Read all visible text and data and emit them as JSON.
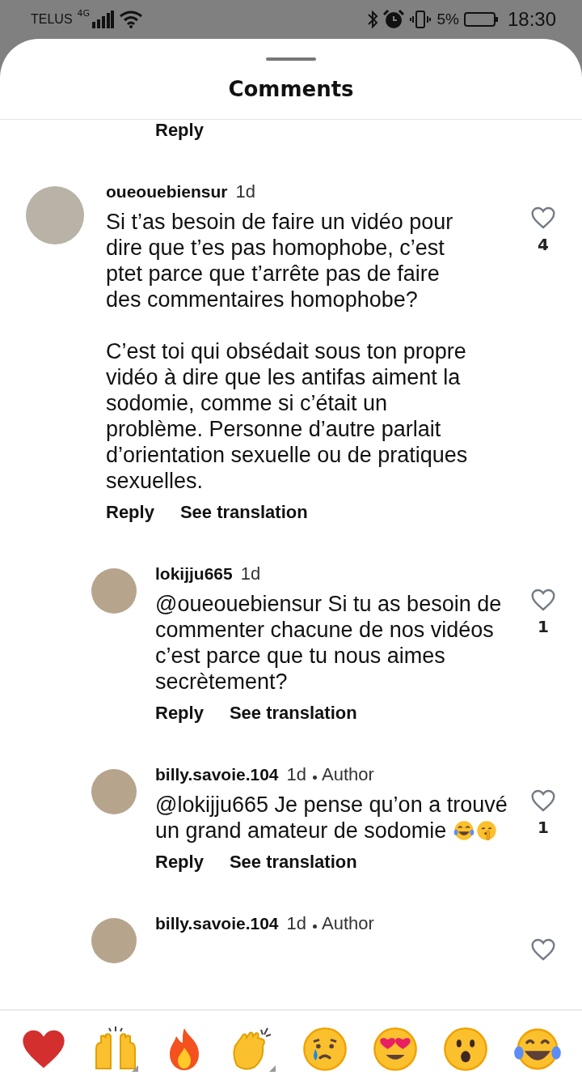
{
  "status_bar": {
    "carrier": "TELUS",
    "network": "4G",
    "battery": "5%",
    "time": "18:30"
  },
  "sheet": {
    "title": "Comments"
  },
  "partial_actions": [
    "Reply"
  ],
  "comments": [
    {
      "username": "oueouebiensur",
      "time": "1d",
      "paragraphs": [
        "Si t’as besoin de faire un vidéo pour dire que t’es pas homophobe, c’est ptet parce que t’arrête pas de faire des commentaires homophobe?",
        "C’est toi qui obsédait sous ton propre vidéo à dire que les antifas aiment la sodomie, comme si c’était un problème. Personne d’autre parlait d’orientation sexuelle ou de pratiques sexuelles."
      ],
      "liked": false,
      "likes": "4",
      "actions": [
        "Reply",
        "See translation"
      ],
      "children": [
        {
          "username": "lokijju665",
          "time": "1d",
          "mention": "@oueouebiensur",
          "paragraphs": [
            "Si tu as besoin de commenter chacune de nos vidéos c’est parce que tu nous aimes secrètement?"
          ],
          "liked": false,
          "likes": "1",
          "actions": [
            "Reply",
            "See translation"
          ]
        },
        {
          "username": "billy.savoie.104",
          "time": "1d",
          "badge": "Author",
          "mention": "@lokijju665",
          "paragraphs": [
            "Je pense qu’on a trouvé un grand amateur de sodomie"
          ],
          "emoji_icons": [
            {
              "kind": "laughing"
            },
            {
              "kind": "shushing"
            }
          ],
          "liked": false,
          "likes": "1",
          "actions": [
            "Reply",
            "See translation"
          ]
        },
        {
          "username": "billy.savoie.104",
          "time": "1d",
          "badge": "Author",
          "liked": false
        }
      ]
    }
  ]
}
